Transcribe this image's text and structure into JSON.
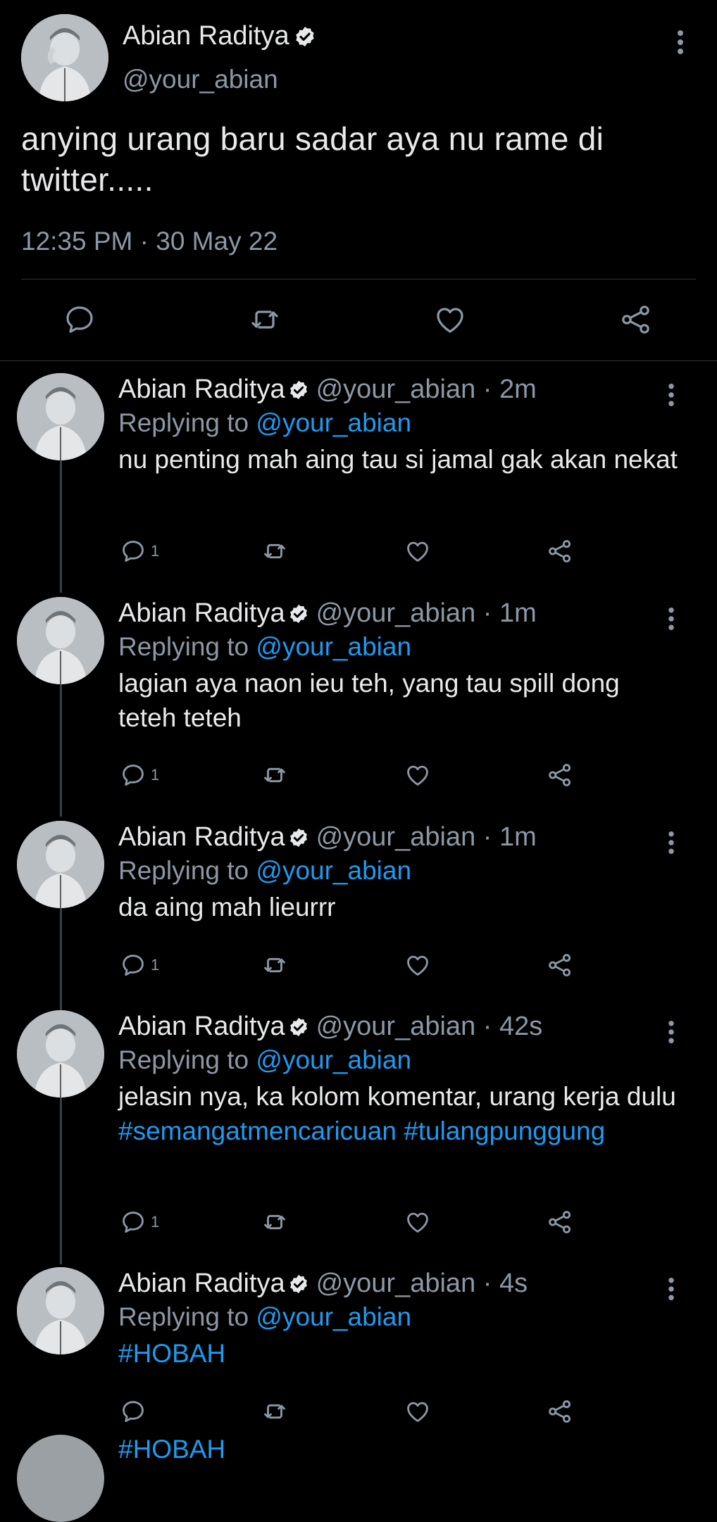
{
  "main_tweet": {
    "name": "Abian Raditya",
    "handle": "@your_abian",
    "text": "anying urang baru sadar aya nu rame di twitter.....",
    "timestamp": "12:35 PM · 30 May 22",
    "actions": [
      "reply-icon",
      "retweet-icon",
      "like-icon",
      "share-icon"
    ]
  },
  "replies": [
    {
      "name": "Abian Raditya",
      "meta": "@your_abian · 2m",
      "replying_prefix": "Replying to",
      "replying_to": "@your_abian",
      "text": "nu penting mah aing tau si jamal gak akan nekat",
      "hashtags": [],
      "reply_count": "1"
    },
    {
      "name": "Abian Raditya",
      "meta": "@your_abian · 1m",
      "replying_prefix": "Replying to",
      "replying_to": "@your_abian",
      "text": "lagian aya naon ieu teh, yang tau spill dong teteh teteh",
      "hashtags": [],
      "reply_count": "1"
    },
    {
      "name": "Abian Raditya",
      "meta": "@your_abian · 1m",
      "replying_prefix": "Replying to",
      "replying_to": "@your_abian",
      "text": "da aing mah lieurrr",
      "hashtags": [],
      "reply_count": "1"
    },
    {
      "name": "Abian Raditya",
      "meta": "@your_abian · 42s",
      "replying_prefix": "Replying to",
      "replying_to": "@your_abian",
      "text": "jelasin nya, ka kolom komentar, urang kerja dulu",
      "hashtags": [
        "#semangatmencaricuan",
        "#tulangpunggung"
      ],
      "reply_count": "1"
    },
    {
      "name": "Abian Raditya",
      "meta": "@your_abian · 4s",
      "replying_prefix": "Replying to",
      "replying_to": "@your_abian",
      "text": "",
      "hashtags": [
        "#HOBAH"
      ],
      "reply_count": ""
    }
  ],
  "peek_text": "#HOBAH",
  "colors": {
    "background": "#000000",
    "text": "#e7e9ea",
    "secondary": "#8b98a5",
    "link": "#1d9bf0",
    "divider": "#2f3336"
  }
}
